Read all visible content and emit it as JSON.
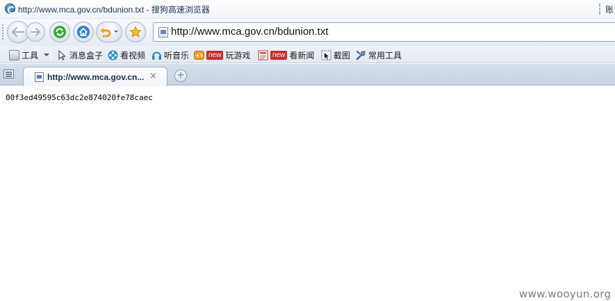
{
  "window": {
    "title_url": "http://www.mca.gov.cn/bdunion.txt",
    "title_separator": " - ",
    "app_name": "搜狗高速浏览器",
    "account_label": "账"
  },
  "address_bar": {
    "url": "http://www.mca.gov.cn/bdunion.txt"
  },
  "toolbar": {
    "items": [
      {
        "label": "工具",
        "icon": "toolbox-icon"
      },
      {
        "label": "消息盒子",
        "icon": "cursor-icon"
      },
      {
        "label": "看视频",
        "icon": "film-reel-icon"
      },
      {
        "label": "听音乐",
        "icon": "headphones-icon"
      },
      {
        "label": "玩游戏",
        "icon": "gamepad-icon",
        "badge": "new"
      },
      {
        "label": "看新闻",
        "icon": "newspaper-icon",
        "badge": "new"
      },
      {
        "label": "截图",
        "icon": "screenshot-icon"
      },
      {
        "label": "常用工具",
        "icon": "wrench-icon"
      }
    ]
  },
  "tabs": [
    {
      "title": "http://www.mca.gov.cn...",
      "close": "×",
      "active": true
    }
  ],
  "new_tab_label": "+",
  "page": {
    "text": "00f3ed49595c63dc2e874020fe78caec"
  },
  "watermark": "www.wooyun.org",
  "colors": {
    "chrome_light": "#f7f9fc",
    "chrome_dark": "#c9d4e2",
    "new_badge": "#d02a1e",
    "title_text": "#1e3552"
  }
}
